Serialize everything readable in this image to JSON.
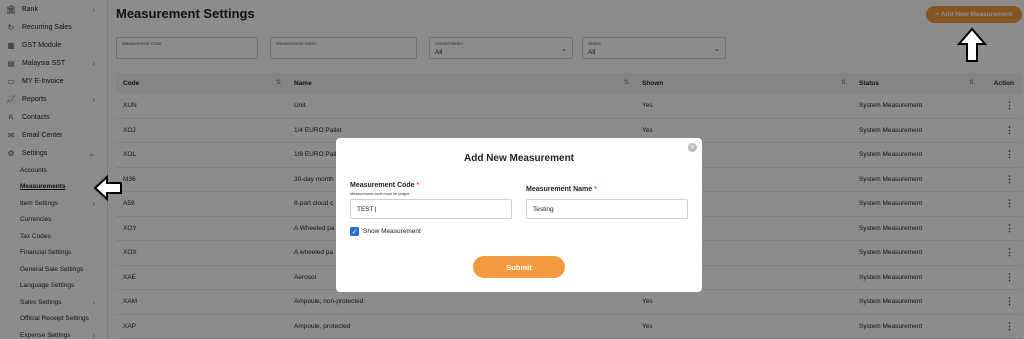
{
  "sidebar": {
    "items": [
      {
        "label": "Bank",
        "icon": "bank-icon",
        "glyph": "🏛",
        "chevron": true
      },
      {
        "label": "Recurring Sales",
        "icon": "recurring-icon",
        "glyph": "↻",
        "chevron": false
      },
      {
        "label": "GST Module",
        "icon": "gst-icon",
        "glyph": "▦",
        "chevron": false
      },
      {
        "label": "Malaysia SST",
        "icon": "sst-icon",
        "glyph": "▤",
        "chevron": true
      },
      {
        "label": "MY E-Invoice",
        "icon": "invoice-icon",
        "glyph": "▭",
        "chevron": false
      },
      {
        "label": "Reports",
        "icon": "chart-icon",
        "glyph": "📈",
        "chevron": true
      },
      {
        "label": "Contacts",
        "icon": "contacts-icon",
        "glyph": "ጸ",
        "chevron": false
      },
      {
        "label": "Email Center",
        "icon": "email-icon",
        "glyph": "✉",
        "chevron": false
      },
      {
        "label": "Settings",
        "icon": "gear-icon",
        "glyph": "⚙",
        "chevron": true
      }
    ],
    "sub_items": [
      {
        "label": "Accounts",
        "chevron": false
      },
      {
        "label": "Measurements",
        "chevron": false
      },
      {
        "label": "Item Settings",
        "chevron": true
      },
      {
        "label": "Currencies",
        "chevron": false
      },
      {
        "label": "Tax Codes",
        "chevron": false
      },
      {
        "label": "Financial Settings",
        "chevron": false
      },
      {
        "label": "General Sale Settings",
        "chevron": false
      },
      {
        "label": "Language Settings",
        "chevron": false
      },
      {
        "label": "Sales Settings",
        "chevron": true
      },
      {
        "label": "Official Receipt Settings",
        "chevron": false
      },
      {
        "label": "Expense Settings",
        "chevron": true
      }
    ]
  },
  "header": {
    "title": "Measurement Settings",
    "add_button": "+ Add New Measurement"
  },
  "filters": {
    "code_label": "Measurement Code",
    "name_label": "Measurement Name",
    "active_label": "Active/Hidden",
    "active_value": "All",
    "status_label": "Status",
    "status_value": "All"
  },
  "table": {
    "headers": {
      "code": "Code",
      "name": "Name",
      "shown": "Shown",
      "status": "Status",
      "action": "Action"
    },
    "rows": [
      {
        "code": "XUN",
        "name": "Unit",
        "shown": "Yes",
        "status": "System Measurement"
      },
      {
        "code": "XOJ",
        "name": "1/4 EURO Pallet",
        "shown": "Yes",
        "status": "System Measurement"
      },
      {
        "code": "XOL",
        "name": "1/8 EURO Pallet",
        "shown": "",
        "status": "System Measurement"
      },
      {
        "code": "M36",
        "name": "30-day month",
        "shown": "",
        "status": "System Measurement"
      },
      {
        "code": "A59",
        "name": "8-part cloud c",
        "shown": "",
        "status": "System Measurement"
      },
      {
        "code": "XOY",
        "name": "A Wheeled pa",
        "shown": "",
        "status": "System Measurement"
      },
      {
        "code": "XOX",
        "name": "A wheeled pa",
        "shown": "",
        "status": "System Measurement"
      },
      {
        "code": "XAE",
        "name": "Aerosol",
        "shown": "",
        "status": "System Measurement"
      },
      {
        "code": "XAM",
        "name": "Ampoule, non-protected",
        "shown": "Yes",
        "status": "System Measurement"
      },
      {
        "code": "XAP",
        "name": "Ampoule, protected",
        "shown": "Yes",
        "status": "System Measurement"
      }
    ]
  },
  "modal": {
    "title": "Add New Measurement",
    "code_label": "Measurement Code",
    "code_hint": "Measurement code must be unique",
    "code_value": "TEST",
    "name_label": "Measurement Name",
    "name_value": "Testing",
    "required_mark": "*",
    "show_label": "Show Measurement",
    "submit": "Submit"
  },
  "colors": {
    "accent": "#f39a40",
    "checkbox": "#2a6fd6"
  }
}
